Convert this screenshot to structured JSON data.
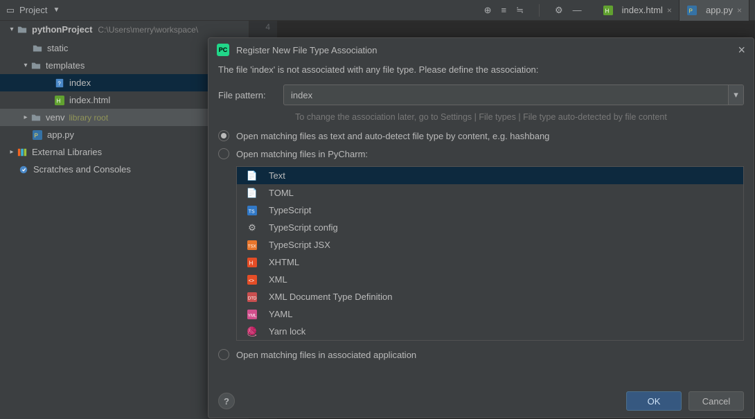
{
  "toolbar": {
    "project_label": "Project"
  },
  "editor": {
    "tabs": [
      {
        "label": "index.html",
        "icon": "html"
      },
      {
        "label": "app.py",
        "icon": "python"
      }
    ],
    "gutter_line": "4"
  },
  "project": {
    "root_name": "pythonProject",
    "root_path": "C:\\Users\\merry\\workspace\\",
    "tree": {
      "static": "static",
      "templates": "templates",
      "index": "index",
      "index_html": "index.html",
      "venv": "venv",
      "venv_tag": "library root",
      "app_py": "app.py",
      "ext_libs": "External Libraries",
      "scratches": "Scratches and Consoles"
    }
  },
  "dialog": {
    "title": "Register New File Type Association",
    "message": "The file 'index' is not associated with any file type. Please define the association:",
    "file_pattern_label": "File pattern:",
    "file_pattern_value": "index",
    "hint": "To change the association later, go to Settings | File types | File type auto-detected by file content",
    "radio1": "Open matching files as text and auto-detect file type by content, e.g. hashbang",
    "radio2": "Open matching files in PyCharm:",
    "radio3": "Open matching files in associated application",
    "ok": "OK",
    "cancel": "Cancel",
    "help": "?",
    "filetypes": [
      "Text",
      "TOML",
      "TypeScript",
      "TypeScript config",
      "TypeScript JSX",
      "XHTML",
      "XML",
      "XML Document Type Definition",
      "YAML",
      "Yarn lock"
    ]
  }
}
